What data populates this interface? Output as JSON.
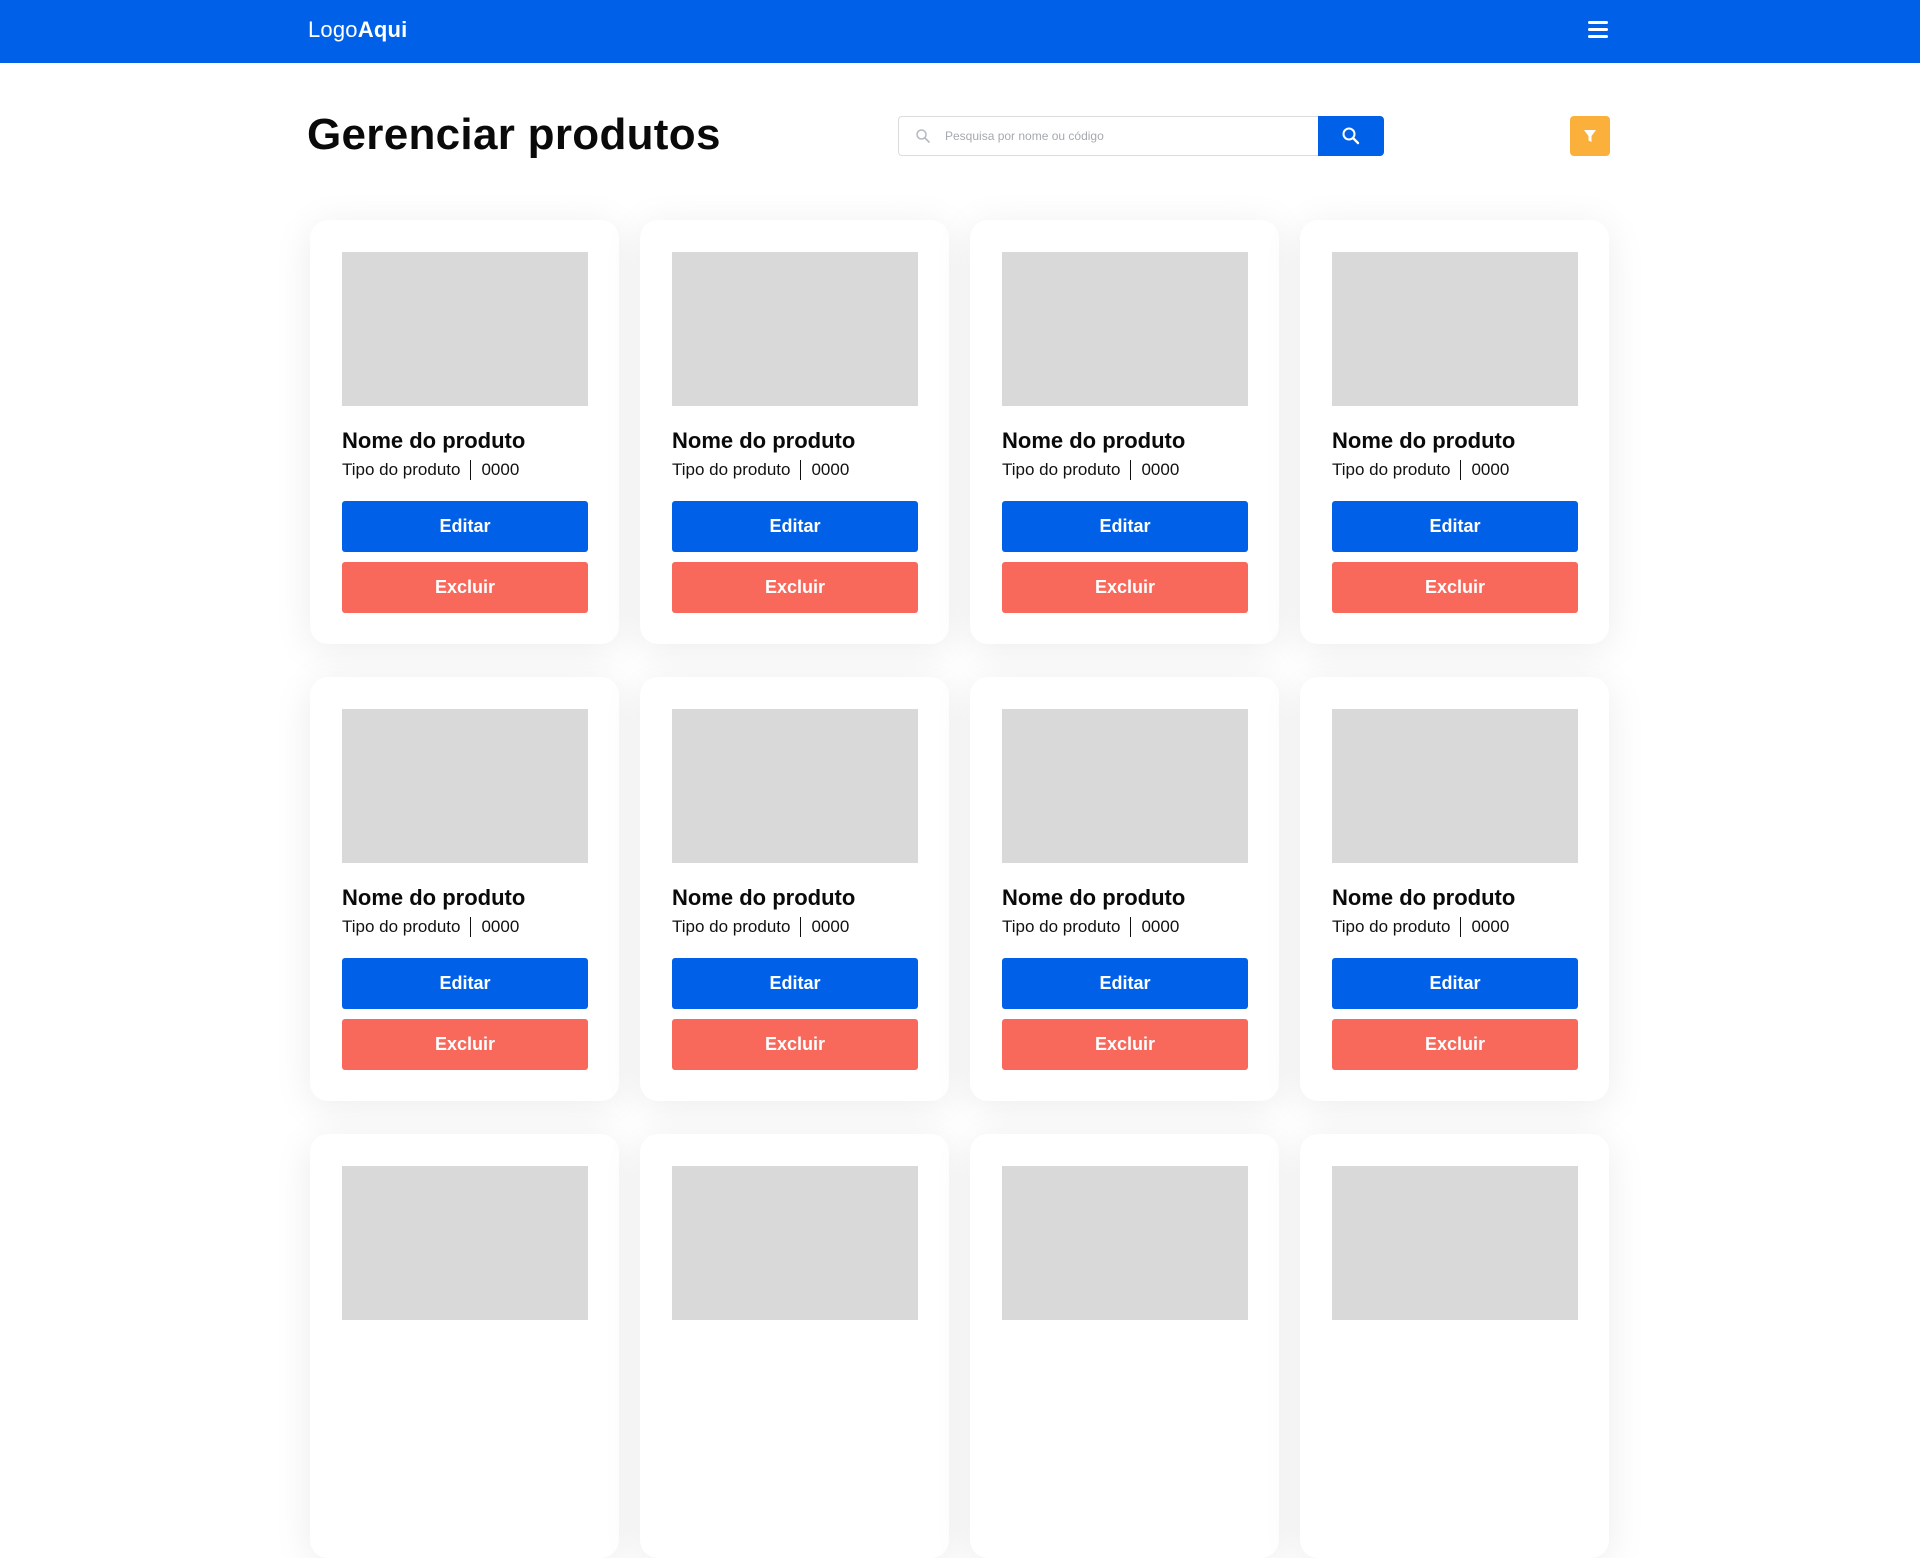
{
  "header": {
    "logo_part1": "Logo",
    "logo_part2": "Aqui",
    "menu_icon": "hamburger-menu-icon",
    "bg_color": "#0061e8"
  },
  "main": {
    "title": "Gerenciar produtos",
    "search": {
      "placeholder": "Pesquisa por nome ou código",
      "icon": "search-icon",
      "button_icon": "search-icon"
    },
    "filter_button": {
      "icon": "filter-icon",
      "color": "#fbb03b"
    }
  },
  "products": [
    {
      "name": "Nome do produto",
      "type": "Tipo do produto",
      "code": "0000",
      "edit_label": "Editar",
      "delete_label": "Excluir"
    },
    {
      "name": "Nome do produto",
      "type": "Tipo do produto",
      "code": "0000",
      "edit_label": "Editar",
      "delete_label": "Excluir"
    },
    {
      "name": "Nome do produto",
      "type": "Tipo do produto",
      "code": "0000",
      "edit_label": "Editar",
      "delete_label": "Excluir"
    },
    {
      "name": "Nome do produto",
      "type": "Tipo do produto",
      "code": "0000",
      "edit_label": "Editar",
      "delete_label": "Excluir"
    },
    {
      "name": "Nome do produto",
      "type": "Tipo do produto",
      "code": "0000",
      "edit_label": "Editar",
      "delete_label": "Excluir"
    },
    {
      "name": "Nome do produto",
      "type": "Tipo do produto",
      "code": "0000",
      "edit_label": "Editar",
      "delete_label": "Excluir"
    },
    {
      "name": "Nome do produto",
      "type": "Tipo do produto",
      "code": "0000",
      "edit_label": "Editar",
      "delete_label": "Excluir"
    },
    {
      "name": "Nome do produto",
      "type": "Tipo do produto",
      "code": "0000",
      "edit_label": "Editar",
      "delete_label": "Excluir"
    },
    {
      "name": "",
      "type": "",
      "code": "",
      "edit_label": "",
      "delete_label": ""
    },
    {
      "name": "",
      "type": "",
      "code": "",
      "edit_label": "",
      "delete_label": ""
    },
    {
      "name": "",
      "type": "",
      "code": "",
      "edit_label": "",
      "delete_label": ""
    },
    {
      "name": "",
      "type": "",
      "code": "",
      "edit_label": "",
      "delete_label": ""
    }
  ],
  "colors": {
    "primary": "#0061e8",
    "danger": "#f8685b",
    "accent": "#fbb03b",
    "placeholder_image": "#d9d9d9"
  }
}
